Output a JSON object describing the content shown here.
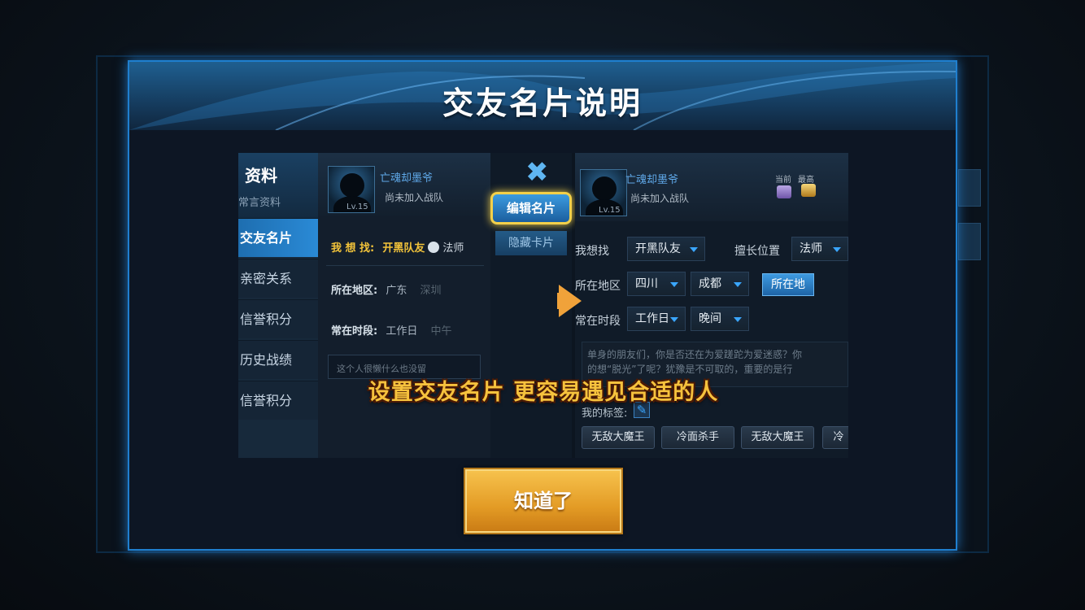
{
  "dialog": {
    "title": "交友名片说明",
    "confirm_label": "知道了"
  },
  "illustration": {
    "caption": "设置交友名片 更容易遇见合适的人",
    "left_panel": {
      "sidebar_title": "资料",
      "sidebar_subtitle": "常言资料",
      "sidebar_items": [
        "交友名片",
        "亲密关系",
        "信誉积分",
        "历史战绩",
        "信誉积分"
      ],
      "player_name": "亡魂却墨爷",
      "team_status": "尚未加入战队",
      "level": "Lv.15",
      "want_label": "我 想 找:",
      "want_value": "开黑队友",
      "role_value": "法师",
      "region_label": "所在地区:",
      "region_value": "广东",
      "region_faded": "深圳",
      "time_label": "常在时段:",
      "time_value": "工作日",
      "time_faded": "中午",
      "desc_placeholder": "这个人很懒什么也没留"
    },
    "middle": {
      "edit_card_label": "编辑名片",
      "hide_card_label": "隐藏卡片"
    },
    "right_panel": {
      "player_name": "亡魂却墨爷",
      "team_status": "尚未加入战队",
      "level": "Lv.15",
      "rank_current_label": "当前",
      "rank_highest_label": "最高",
      "want_label": "我想找",
      "want_value": "开黑队友",
      "role_label": "擅长位置",
      "role_value": "法师",
      "region_label": "所在地区",
      "province_value": "四川",
      "city_value": "成都",
      "location_button": "所在地",
      "time_label": "常在时段",
      "day_value": "工作日",
      "period_value": "晚间",
      "desc_line1": "单身的朋友们，你是否还在为爱蹉跎为爱迷惑？你",
      "desc_line2": "的想“脱光”了呢？犹豫是不可取的，重要的是行",
      "tags_label": "我的标签:",
      "tags": [
        "无敌大魔王",
        "冷面杀手",
        "无敌大魔王",
        "冷"
      ]
    }
  },
  "colors": {
    "accent_blue": "#1f7fcf",
    "caption_gold": "#f6c23d",
    "button_gold": "#e39b25"
  }
}
